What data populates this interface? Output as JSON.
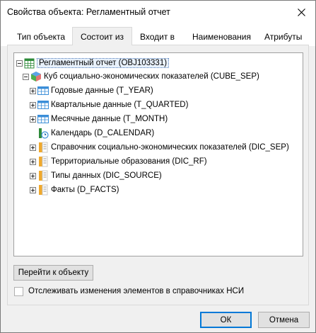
{
  "window": {
    "title": "Свойства объекта: Регламентный отчет"
  },
  "tabs": [
    {
      "label": "Тип объекта",
      "active": false
    },
    {
      "label": "Состоит из",
      "active": true
    },
    {
      "label": "Входит в",
      "active": false
    },
    {
      "label": "Наименования",
      "active": false
    },
    {
      "label": "Атрибуты",
      "active": false
    }
  ],
  "tree": {
    "root": {
      "label": "Регламентный отчет (OBJ103331)",
      "icon": "report-icon",
      "expanded": true,
      "selected": true
    },
    "cube": {
      "label": "Куб социально-экономических показателей (CUBE_SEP)",
      "icon": "cube-icon",
      "expanded": true
    },
    "children": [
      {
        "label": "Годовые данные (T_YEAR)",
        "icon": "table-icon",
        "expandable": true
      },
      {
        "label": "Квартальные данные (T_QUARTED)",
        "icon": "table-icon",
        "expandable": true
      },
      {
        "label": "Месячные данные (T_MONTH)",
        "icon": "table-icon",
        "expandable": true
      },
      {
        "label": "Календарь (D_CALENDAR)",
        "icon": "calendar-dictionary-icon",
        "expandable": false
      },
      {
        "label": "Справочник социально-экономических показателей (DIC_SEP)",
        "icon": "dictionary-icon",
        "expandable": true
      },
      {
        "label": "Территориальные образования (DIC_RF)",
        "icon": "dictionary-icon",
        "expandable": true
      },
      {
        "label": "Типы данных (DIC_SOURCE)",
        "icon": "dictionary-icon",
        "expandable": true
      },
      {
        "label": "Факты (D_FACTS)",
        "icon": "dictionary-icon",
        "expandable": true
      }
    ]
  },
  "goto_button": "Перейти к объекту",
  "track_checkbox": {
    "label": "Отслеживать изменения элементов в справочниках НСИ",
    "checked": false
  },
  "footer": {
    "ok": "ОК",
    "cancel": "Отмена"
  },
  "colors": {
    "accent": "#0078d7",
    "selection": "#e8f1fb",
    "dictionary": "#f0a92c",
    "table": "#3b8ed8"
  }
}
